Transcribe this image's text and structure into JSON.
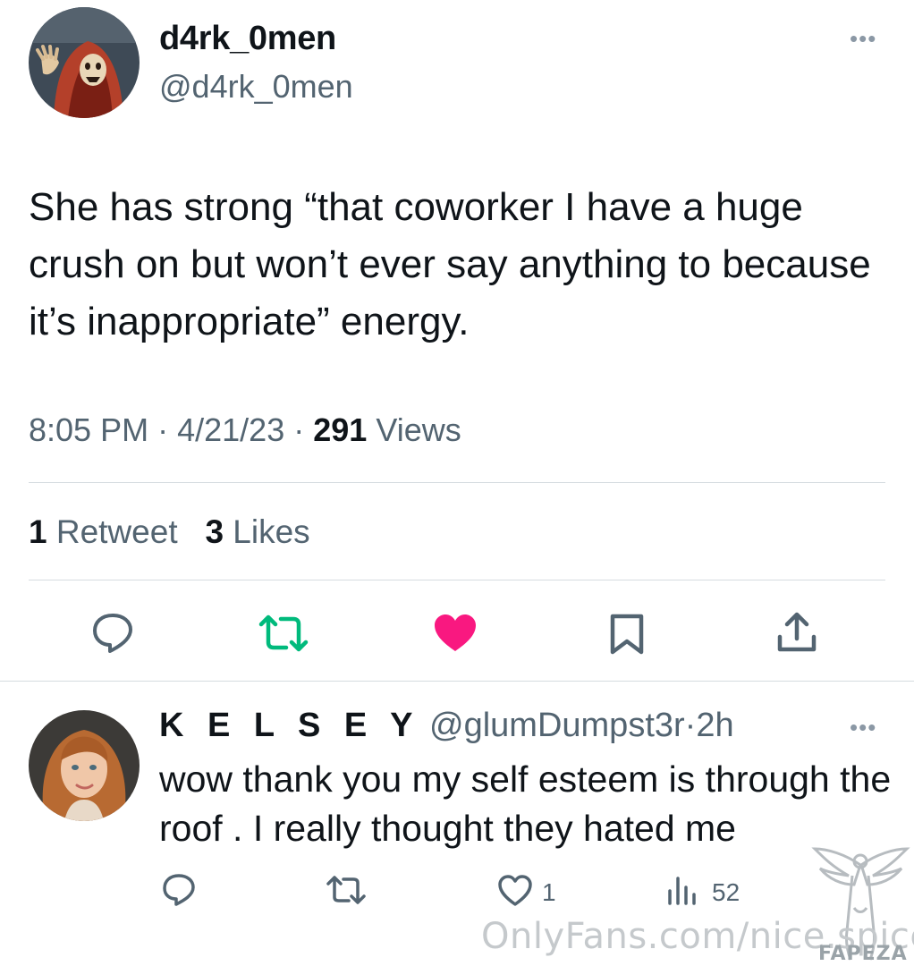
{
  "tweet": {
    "author": {
      "display_name": "d4rk_0men",
      "handle": "@d4rk_0men",
      "avatar": "hooded-figure-avatar"
    },
    "more_icon": "more-dots-icon",
    "text": "She has strong “that coworker I have a huge crush on but won’t ever say anything to because it’s inappropriate” energy.",
    "time": "8:05 PM",
    "sep": "·",
    "date": "4/21/23",
    "views_count": "291",
    "views_label": "Views",
    "retweets_count": "1",
    "retweets_label": "Retweet",
    "likes_count": "3",
    "likes_label": "Likes",
    "actions": [
      {
        "name": "reply",
        "icon": "reply-bubble-icon",
        "color": "#536471"
      },
      {
        "name": "retweet",
        "icon": "retweet-icon",
        "color": "#00ba7c"
      },
      {
        "name": "like",
        "icon": "heart-icon",
        "color": "#f91880",
        "active": true
      },
      {
        "name": "bookmark",
        "icon": "bookmark-icon",
        "color": "#536471"
      },
      {
        "name": "share",
        "icon": "share-icon",
        "color": "#536471"
      }
    ]
  },
  "reply": {
    "author": {
      "display_name": "K E L S E Y",
      "handle": "@glumDumpst3r",
      "avatar": "woman-photo-avatar"
    },
    "sep": "·",
    "age": "2h",
    "text": "wow thank you my self esteem is through the roof . I really thought they hated me",
    "like_count": "1",
    "views_count": "52"
  },
  "watermark": {
    "text": "OnlyFans.com/nice.spice",
    "logo_text": "FAPEZA"
  },
  "colors": {
    "text_primary": "#0f1419",
    "text_secondary": "#536471",
    "divider": "#d6dce0",
    "like_active": "#f91880",
    "retweet": "#00ba7c"
  }
}
